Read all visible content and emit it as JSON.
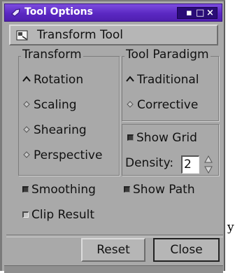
{
  "window": {
    "title": "Tool Options",
    "wm_buttons": {
      "minimize": "▪",
      "maximize": "□",
      "close": "×"
    },
    "accent_color": "#5b28c2"
  },
  "tool": {
    "name": "Transform Tool",
    "icon": "transform-tool-icon"
  },
  "transform": {
    "label": "Transform",
    "options": [
      {
        "label": "Rotation",
        "selected": true
      },
      {
        "label": "Scaling",
        "selected": false
      },
      {
        "label": "Shearing",
        "selected": false
      },
      {
        "label": "Perspective",
        "selected": false
      }
    ]
  },
  "paradigm": {
    "label": "Tool Paradigm",
    "options": [
      {
        "label": "Traditional",
        "selected": true
      },
      {
        "label": "Corrective",
        "selected": false
      }
    ]
  },
  "grid": {
    "show_grid_label": "Show Grid",
    "show_grid_checked": true,
    "density_label": "Density:",
    "density_value": "2"
  },
  "options": {
    "smoothing_label": "Smoothing",
    "smoothing_checked": true,
    "show_path_label": "Show Path",
    "show_path_checked": true,
    "clip_result_label": "Clip Result",
    "clip_result_checked": false
  },
  "buttons": {
    "reset": "Reset",
    "close": "Close"
  },
  "edge_text": "y"
}
